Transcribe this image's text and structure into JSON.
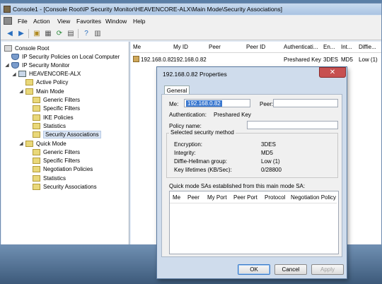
{
  "window": {
    "title": "Console1 - [Console Root\\IP Security Monitor\\HEAVENCORE-ALX\\Main Mode\\Security Associations]"
  },
  "menubar": {
    "items": [
      "File",
      "Action",
      "View",
      "Favorites",
      "Window",
      "Help"
    ]
  },
  "toolbar": {
    "icons": [
      "back-arrow-icon",
      "forward-arrow-icon",
      "up-folder-icon",
      "show-hide-tree-icon",
      "refresh-icon",
      "export-icon",
      "help-icon",
      "properties-icon"
    ]
  },
  "tree": {
    "root": "Console Root",
    "items": [
      {
        "label": "IP Security Policies on Local Computer",
        "level": 1,
        "icon": "shield-icon",
        "expander": ""
      },
      {
        "label": "IP Security Monitor",
        "level": 1,
        "icon": "shield-icon",
        "expander": "expanded"
      },
      {
        "label": "HEAVENCORE-ALX",
        "level": 2,
        "icon": "computer-icon",
        "expander": "expanded"
      },
      {
        "label": "Active Policy",
        "level": 3,
        "icon": "folder-icon",
        "expander": ""
      },
      {
        "label": "Main Mode",
        "level": 3,
        "icon": "folder-icon",
        "expander": "expanded"
      },
      {
        "label": "Generic Filters",
        "level": 4,
        "icon": "folder-icon",
        "expander": ""
      },
      {
        "label": "Specific Filters",
        "level": 4,
        "icon": "folder-icon",
        "expander": ""
      },
      {
        "label": "IKE Policies",
        "level": 4,
        "icon": "folder-icon",
        "expander": ""
      },
      {
        "label": "Statistics",
        "level": 4,
        "icon": "folder-icon",
        "expander": ""
      },
      {
        "label": "Security Associations",
        "level": 4,
        "icon": "folder-icon",
        "expander": "",
        "selected": true
      },
      {
        "label": "Quick Mode",
        "level": 3,
        "icon": "folder-icon",
        "expander": "expanded"
      },
      {
        "label": "Generic Filters",
        "level": 4,
        "icon": "folder-icon",
        "expander": ""
      },
      {
        "label": "Specific Filters",
        "level": 4,
        "icon": "folder-icon",
        "expander": ""
      },
      {
        "label": "Negotiation Policies",
        "level": 4,
        "icon": "folder-icon",
        "expander": ""
      },
      {
        "label": "Statistics",
        "level": 4,
        "icon": "folder-icon",
        "expander": ""
      },
      {
        "label": "Security Associations",
        "level": 4,
        "icon": "folder-icon",
        "expander": ""
      }
    ]
  },
  "list": {
    "columns": [
      "Me",
      "My ID",
      "Peer",
      "Peer ID",
      "Authenticati...",
      "En...",
      "Int...",
      "Diffie..."
    ],
    "rows": [
      [
        "192.168.0.82",
        "192.168.0.82",
        "",
        "",
        "Preshared Key",
        "3DES",
        "MD5",
        "Low (1)"
      ]
    ]
  },
  "dialog": {
    "title": "192.168.0.82 Properties",
    "close_glyph": "✕",
    "tab": "General",
    "me_label": "Me:",
    "me_value": "192.168.0.82",
    "peer_label": "Peer:",
    "peer_value": "",
    "auth_label": "Authentication:",
    "auth_value": "Preshared Key",
    "policy_label": "Policy name:",
    "policy_value": "",
    "method_title": "Selected security method",
    "method": [
      {
        "label": "Encryption:",
        "value": "3DES"
      },
      {
        "label": "Integrity:",
        "value": "MD5"
      },
      {
        "label": "Diffie-Hellman group:",
        "value": "Low (1)"
      },
      {
        "label": "Key lifetimes (KB/Sec):",
        "value": "0/28800"
      }
    ],
    "quick_mode_title": "Quick mode SAs established from this main mode SA:",
    "quick_mode_columns": [
      "Me",
      "Peer",
      "My Port",
      "Peer Port",
      "Protocol",
      "Negotiation Policy"
    ],
    "buttons": {
      "ok": "OK",
      "cancel": "Cancel",
      "apply": "Apply"
    }
  }
}
